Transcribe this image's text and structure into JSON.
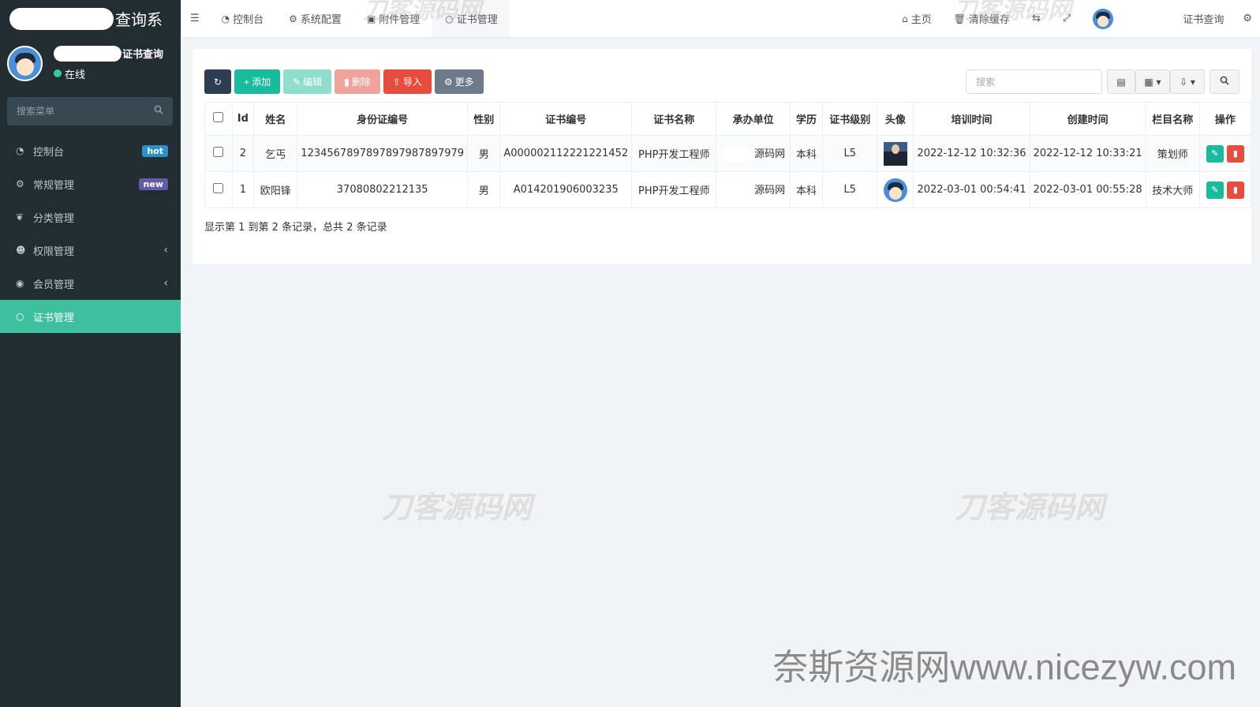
{
  "app": {
    "title_suffix": "查询系",
    "user_name_suffix": "证书查询",
    "status": "在线"
  },
  "sidebar": {
    "search_placeholder": "搜索菜单",
    "items": [
      {
        "label": "控制台",
        "icon": "dashboard-icon",
        "badge": "hot"
      },
      {
        "label": "常规管理",
        "icon": "cogs-icon",
        "badge": "new"
      },
      {
        "label": "分类管理",
        "icon": "leaf-icon"
      },
      {
        "label": "权限管理",
        "icon": "group-icon"
      },
      {
        "label": "会员管理",
        "icon": "user-circle-icon"
      },
      {
        "label": "证书管理",
        "icon": "circle-icon",
        "active": true
      }
    ]
  },
  "topbar": {
    "tabs": [
      {
        "label": "控制台",
        "icon": "dashboard-icon"
      },
      {
        "label": "系统配置",
        "icon": "gear-icon"
      },
      {
        "label": "附件管理",
        "icon": "file-image-icon"
      },
      {
        "label": "证书管理",
        "icon": "circle-icon",
        "active": true
      }
    ],
    "home": "主页",
    "clear_cache": "清除缓存",
    "cert_query": "证书查询"
  },
  "toolbar": {
    "add": "添加",
    "edit": "编辑",
    "delete": "删除",
    "import": "导入",
    "more": "更多",
    "search_placeholder": "搜索"
  },
  "table": {
    "headers": [
      "Id",
      "姓名",
      "身份证编号",
      "性别",
      "证书编号",
      "证书名称",
      "承办单位",
      "学历",
      "证书级别",
      "头像",
      "培训时间",
      "创建时间",
      "栏目名称",
      "操作"
    ],
    "rows": [
      {
        "id": "2",
        "name": "乞丐",
        "id_number": "123456789789789798789797​9",
        "gender": "男",
        "cert_no": "A000002112221221452",
        "cert_name": "PHP开发工程师",
        "unit": "源码网",
        "edu": "本科",
        "level": "L5",
        "avatar": "photo",
        "train_time": "2022-12-12 10:32:36",
        "created": "2022-12-12 10:33:21",
        "column": "策划师"
      },
      {
        "id": "1",
        "name": "欧阳锋",
        "id_number": "37080802212135",
        "gender": "男",
        "cert_no": "A014201906003235",
        "cert_name": "PHP开发工程师",
        "unit": "源码网",
        "edu": "本科",
        "level": "L5",
        "avatar": "cartoon",
        "train_time": "2022-03-01 00:54:41",
        "created": "2022-03-01 00:55:28",
        "column": "技术大师"
      }
    ],
    "footer": "显示第 1 到第 2 条记录，总共 2 条记录"
  },
  "watermarks": {
    "main": "刀客源码网",
    "bottom": "奈斯资源网www.nicezyw.com"
  },
  "colors": {
    "sidebar_bg": "#222d32",
    "accent": "#18bc9c",
    "danger": "#e74c3c",
    "active_menu": "#3ebf9f"
  }
}
